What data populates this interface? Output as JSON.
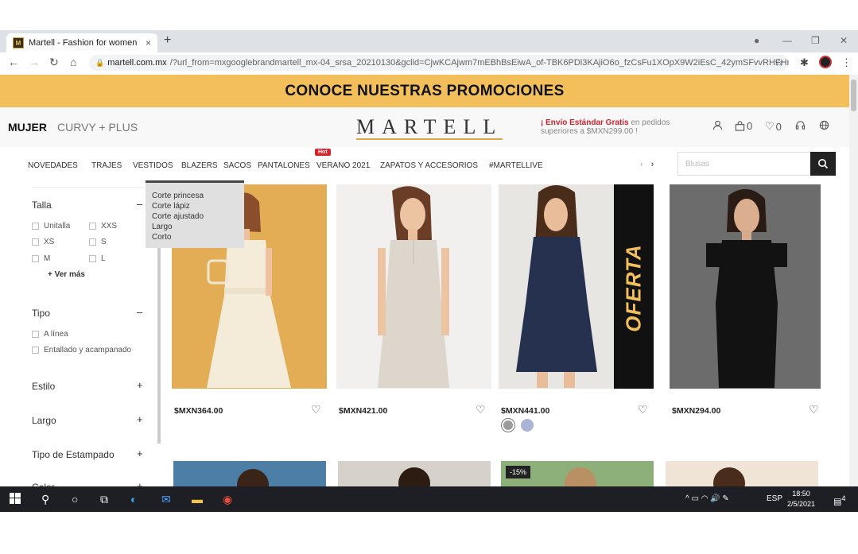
{
  "browser": {
    "tab_title": "Martell - Fashion for women",
    "tab_close": "×",
    "new_tab": "+",
    "url_host": "martell.com.mx",
    "url_path": "/?url_from=mxgooglebrandmartell_mx-04_srsa_20210130&gclid=CjwKCAjwm7mEBhBsEiwA_of-TBK6PDl3KAjiO6o_fzCsFu1XOpX9W2iEsC_42ymSFvvRHFHr..."
  },
  "promo": {
    "text": "CONOCE NUESTRAS PROMOCIONES"
  },
  "header": {
    "segments": [
      "MUJER",
      "CURVY + PLUS"
    ],
    "logo": "MARTELL",
    "shipping_bold": "¡ Envío Estándar Gratis",
    "shipping_rest": " en pedidos",
    "shipping_line2": "superiores a $MXN299.00 !",
    "cart_count": "0",
    "wish_count": "0"
  },
  "nav": {
    "items": [
      "NOVEDADES",
      "TRAJES",
      "VESTIDOS",
      "BLAZERS",
      "SACOS",
      "PANTALONES",
      "VERANO 2021",
      "ZAPATOS Y ACCESORIOS",
      "#MARTELLIVE"
    ],
    "hot_badge": "Hot",
    "search_placeholder": "Blusas"
  },
  "dropdown": {
    "items": [
      "Corte princesa",
      "Corte lápiz",
      "Corte ajustado",
      "Largo",
      "Corto"
    ]
  },
  "filters": {
    "talla": {
      "title": "Talla",
      "sign": "–",
      "options": [
        "Unitalla",
        "XXS",
        "XS",
        "S",
        "M",
        "L"
      ],
      "more": "+ Ver más"
    },
    "tipo": {
      "title": "Tipo",
      "sign": "–",
      "options": [
        "A línea",
        "Entallado y acampanado"
      ]
    },
    "estilo": {
      "title": "Estilo",
      "sign": "+"
    },
    "largo": {
      "title": "Largo",
      "sign": "+"
    },
    "estampado": {
      "title": "Tipo de Estampado",
      "sign": "+"
    },
    "color": {
      "title": "Color",
      "sign": "+"
    }
  },
  "products": [
    {
      "price": "$MXN364.00"
    },
    {
      "price": "$MXN421.00"
    },
    {
      "price": "$MXN441.00",
      "tag": "OFERTA"
    },
    {
      "price": "$MXN294.00"
    }
  ],
  "row2": {
    "discount_badge": "-15%"
  },
  "taskbar": {
    "lang": "ESP",
    "time": "18:50",
    "date": "2/5/2021",
    "notif": "4"
  },
  "colors": {
    "promo": "#f2bf5a",
    "accent_red": "#d2212c",
    "swatch_grey": "#9a9a9a",
    "swatch_blue": "#aab4d6"
  }
}
